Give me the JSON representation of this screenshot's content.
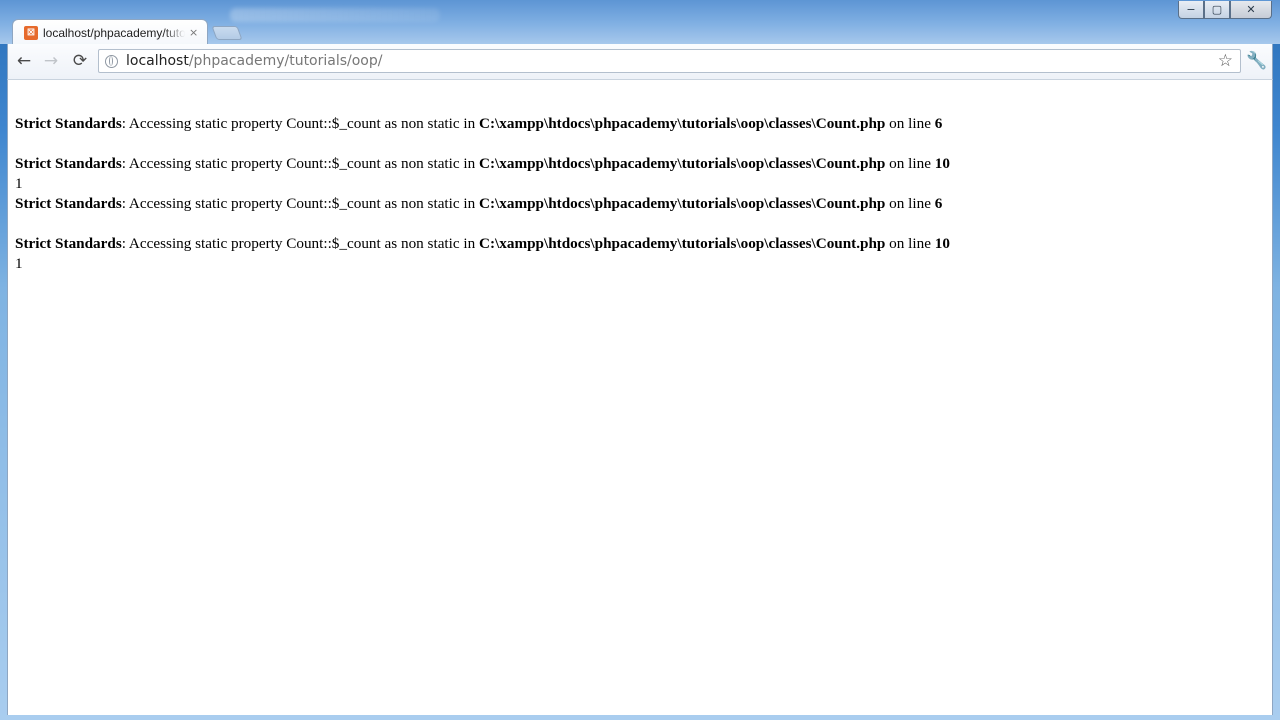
{
  "window": {
    "minimize_glyph": "−",
    "maximize_glyph": "▢",
    "close_glyph": "✕"
  },
  "tab": {
    "title": "localhost/phpacademy/tutorials/oop/",
    "favicon_glyph": "⊠",
    "close_glyph": "×"
  },
  "toolbar": {
    "back_glyph": "←",
    "forward_glyph": "→",
    "reload_glyph": "⟳",
    "url_host": "localhost",
    "url_path": "/phpacademy/tutorials/oop/",
    "star_glyph": "☆",
    "wrench_glyph": "🔧"
  },
  "page": {
    "messages": [
      {
        "label": "Strict Standards",
        "text": ": Accessing static property Count::$_count as non static in ",
        "file": "C:\\xampp\\htdocs\\phpacademy\\tutorials\\oop\\classes\\Count.php",
        "online": " on line ",
        "line": "6"
      },
      {
        "label": "Strict Standards",
        "text": ": Accessing static property Count::$_count as non static in ",
        "file": "C:\\xampp\\htdocs\\phpacademy\\tutorials\\oop\\classes\\Count.php",
        "online": " on line ",
        "line": "10"
      },
      {
        "label": "Strict Standards",
        "text": ": Accessing static property Count::$_count as non static in ",
        "file": "C:\\xampp\\htdocs\\phpacademy\\tutorials\\oop\\classes\\Count.php",
        "online": " on line ",
        "line": "6"
      },
      {
        "label": "Strict Standards",
        "text": ": Accessing static property Count::$_count as non static in ",
        "file": "C:\\xampp\\htdocs\\phpacademy\\tutorials\\oop\\classes\\Count.php",
        "online": " on line ",
        "line": "10"
      }
    ],
    "outputs": [
      "1",
      "1"
    ]
  },
  "colors": {
    "favicon": "#e66a2c",
    "window_frame": "#3f86cf",
    "page_background": "#ffffff"
  }
}
